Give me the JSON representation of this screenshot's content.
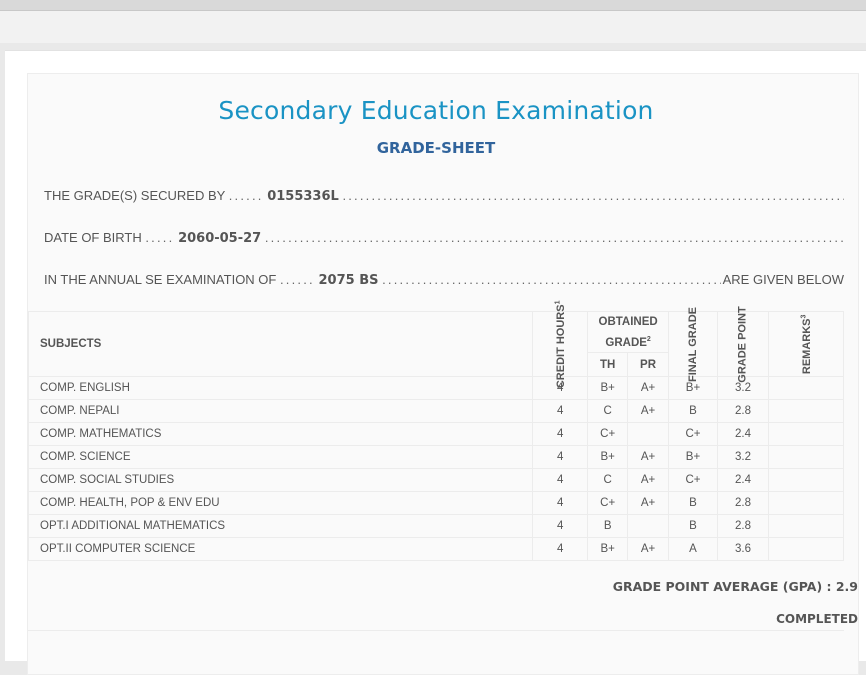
{
  "header": {
    "title": "Secondary Education Examination",
    "subtitle": "GRADE-SHEET"
  },
  "details": {
    "secured_by_label": "THE GRADE(S) SECURED BY",
    "symbol_no": "0155336L",
    "dob_label": "DATE OF BIRTH",
    "dob": "2060-05-27",
    "exam_label": "IN THE ANNUAL SE EXAMINATION OF",
    "exam_year": "2075 BS",
    "exam_tail": "ARE GIVEN BELOW",
    "dots_short": "......",
    "dots_short5": ".....",
    "dots_long": "........................................................................................................................"
  },
  "table": {
    "headers": {
      "subjects": "SUBJECTS",
      "credit_hours": "CREDIT HOURS",
      "credit_sup": "1",
      "obtained_grade": "OBTAINED GRADE",
      "obtained_sup": "2",
      "th": "TH",
      "pr": "PR",
      "final_grade": "FINAL GRADE",
      "grade_point": "GRADE POINT",
      "remarks": "REMARKS",
      "remarks_sup": "3"
    },
    "rows": [
      {
        "subject": "COMP. ENGLISH",
        "credit": "4",
        "th": "B+",
        "pr": "A+",
        "final": "B+",
        "gp": "3.2",
        "remarks": ""
      },
      {
        "subject": "COMP. NEPALI",
        "credit": "4",
        "th": "C",
        "pr": "A+",
        "final": "B",
        "gp": "2.8",
        "remarks": ""
      },
      {
        "subject": "COMP. MATHEMATICS",
        "credit": "4",
        "th": "C+",
        "pr": "",
        "final": "C+",
        "gp": "2.4",
        "remarks": ""
      },
      {
        "subject": "COMP. SCIENCE",
        "credit": "4",
        "th": "B+",
        "pr": "A+",
        "final": "B+",
        "gp": "3.2",
        "remarks": ""
      },
      {
        "subject": "COMP. SOCIAL STUDIES",
        "credit": "4",
        "th": "C",
        "pr": "A+",
        "final": "C+",
        "gp": "2.4",
        "remarks": ""
      },
      {
        "subject": "COMP. HEALTH, POP & ENV EDU",
        "credit": "4",
        "th": "C+",
        "pr": "A+",
        "final": "B",
        "gp": "2.8",
        "remarks": ""
      },
      {
        "subject": "OPT.I ADDITIONAL MATHEMATICS",
        "credit": "4",
        "th": "B",
        "pr": "",
        "final": "B",
        "gp": "2.8",
        "remarks": ""
      },
      {
        "subject": "OPT.II COMPUTER SCIENCE",
        "credit": "4",
        "th": "B+",
        "pr": "A+",
        "final": "A",
        "gp": "3.6",
        "remarks": ""
      }
    ]
  },
  "summary": {
    "gpa_text": "GRADE POINT AVERAGE (GPA) : 2.9",
    "status": "COMPLETED"
  },
  "colors": {
    "title": "#1a93c4",
    "subtitle": "#31649c",
    "text": "#555555"
  }
}
